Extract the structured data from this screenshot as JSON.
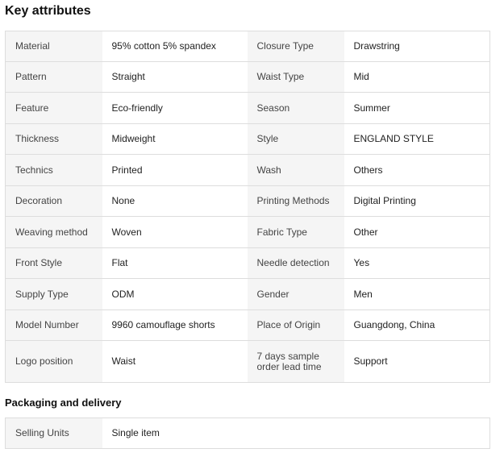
{
  "key_attributes": {
    "title": "Key attributes",
    "rows": [
      [
        {
          "k": "Material",
          "v": "95% cotton 5% spandex"
        },
        {
          "k": "Closure Type",
          "v": "Drawstring"
        }
      ],
      [
        {
          "k": "Pattern",
          "v": "Straight"
        },
        {
          "k": "Waist Type",
          "v": "Mid"
        }
      ],
      [
        {
          "k": "Feature",
          "v": "Eco-friendly"
        },
        {
          "k": "Season",
          "v": "Summer"
        }
      ],
      [
        {
          "k": "Thickness",
          "v": "Midweight"
        },
        {
          "k": "Style",
          "v": "ENGLAND STYLE"
        }
      ],
      [
        {
          "k": "Technics",
          "v": "Printed"
        },
        {
          "k": "Wash",
          "v": "Others"
        }
      ],
      [
        {
          "k": "Decoration",
          "v": "None"
        },
        {
          "k": "Printing Methods",
          "v": "Digital Printing"
        }
      ],
      [
        {
          "k": "Weaving method",
          "v": "Woven"
        },
        {
          "k": "Fabric Type",
          "v": "Other"
        }
      ],
      [
        {
          "k": "Front Style",
          "v": "Flat"
        },
        {
          "k": "Needle detection",
          "v": "Yes"
        }
      ],
      [
        {
          "k": "Supply Type",
          "v": "ODM"
        },
        {
          "k": "Gender",
          "v": "Men"
        }
      ],
      [
        {
          "k": "Model Number",
          "v": "9960 camouflage shorts"
        },
        {
          "k": "Place of Origin",
          "v": "Guangdong, China"
        }
      ],
      [
        {
          "k": "Logo position",
          "v": "Waist"
        },
        {
          "k": "7 days sample order lead time",
          "v": "Support"
        }
      ]
    ]
  },
  "packaging": {
    "title": "Packaging and delivery",
    "rows": [
      [
        {
          "k": "Selling Units",
          "v": "Single item"
        }
      ]
    ]
  }
}
